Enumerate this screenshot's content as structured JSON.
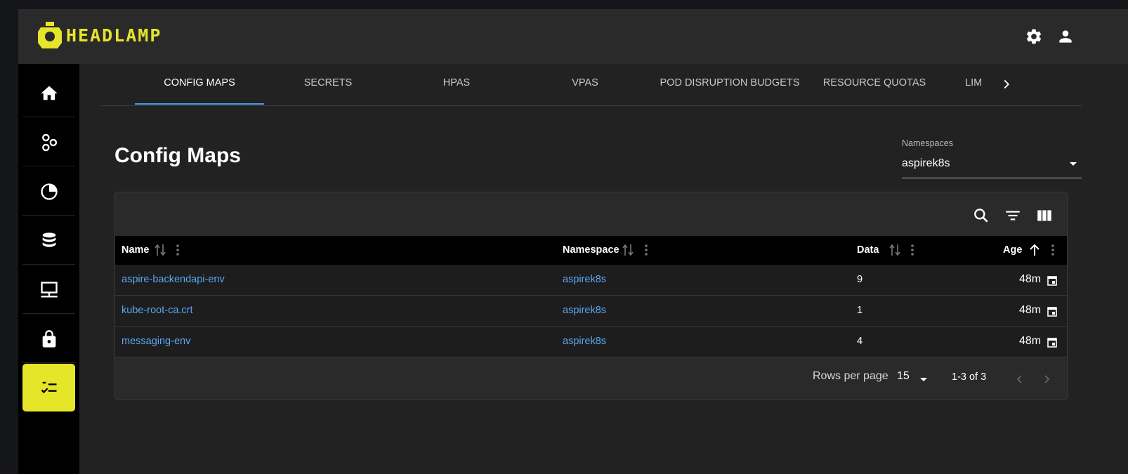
{
  "app": {
    "logo_text": "HEADLAMP"
  },
  "tabs": [
    {
      "label": "CONFIG MAPS",
      "active": true
    },
    {
      "label": "SECRETS"
    },
    {
      "label": "HPAS"
    },
    {
      "label": "VPAS"
    },
    {
      "label": "POD DISRUPTION BUDGETS"
    },
    {
      "label": "RESOURCE QUOTAS"
    },
    {
      "label": "LIM"
    }
  ],
  "page": {
    "title": "Config Maps"
  },
  "namespace_select": {
    "label": "Namespaces",
    "value": "aspirek8s"
  },
  "table": {
    "columns": [
      "Name",
      "Namespace",
      "Data",
      "Age"
    ],
    "rows": [
      {
        "name": "aspire-backendapi-env",
        "namespace": "aspirek8s",
        "data": "9",
        "age": "48m"
      },
      {
        "name": "kube-root-ca.crt",
        "namespace": "aspirek8s",
        "data": "1",
        "age": "48m"
      },
      {
        "name": "messaging-env",
        "namespace": "aspirek8s",
        "data": "4",
        "age": "48m"
      }
    ],
    "rows_per_page_label": "Rows per page",
    "rows_per_page": "15",
    "pagination": "1-3 of 3"
  },
  "colors": {
    "accent": "#e5e52a",
    "link": "#5aa7f2",
    "tab_indicator": "#4a9be8"
  },
  "icons": {
    "sidebar": [
      "home-icon",
      "cluster-icon",
      "workloads-icon",
      "storage-icon",
      "network-icon",
      "security-icon",
      "configuration-icon"
    ],
    "topbar": [
      "settings-icon",
      "user-icon"
    ],
    "toolbar": [
      "search-icon",
      "filter-icon",
      "columns-icon"
    ]
  }
}
